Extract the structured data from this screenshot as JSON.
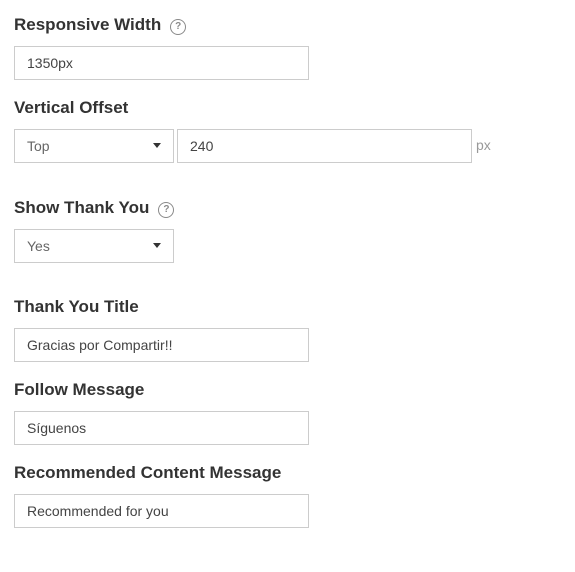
{
  "responsive_width": {
    "label": "Responsive Width",
    "help": "?",
    "value": "1350px"
  },
  "vertical_offset": {
    "label": "Vertical Offset",
    "position_value": "Top",
    "offset_value": "240",
    "unit": "px"
  },
  "show_thank_you": {
    "label": "Show Thank You",
    "help": "?",
    "value": "Yes"
  },
  "thank_you_title": {
    "label": "Thank You Title",
    "value": "Gracias por Compartir!!"
  },
  "follow_message": {
    "label": "Follow Message",
    "value": "Síguenos"
  },
  "recommended_content_message": {
    "label": "Recommended Content Message",
    "value": "Recommended for you"
  }
}
